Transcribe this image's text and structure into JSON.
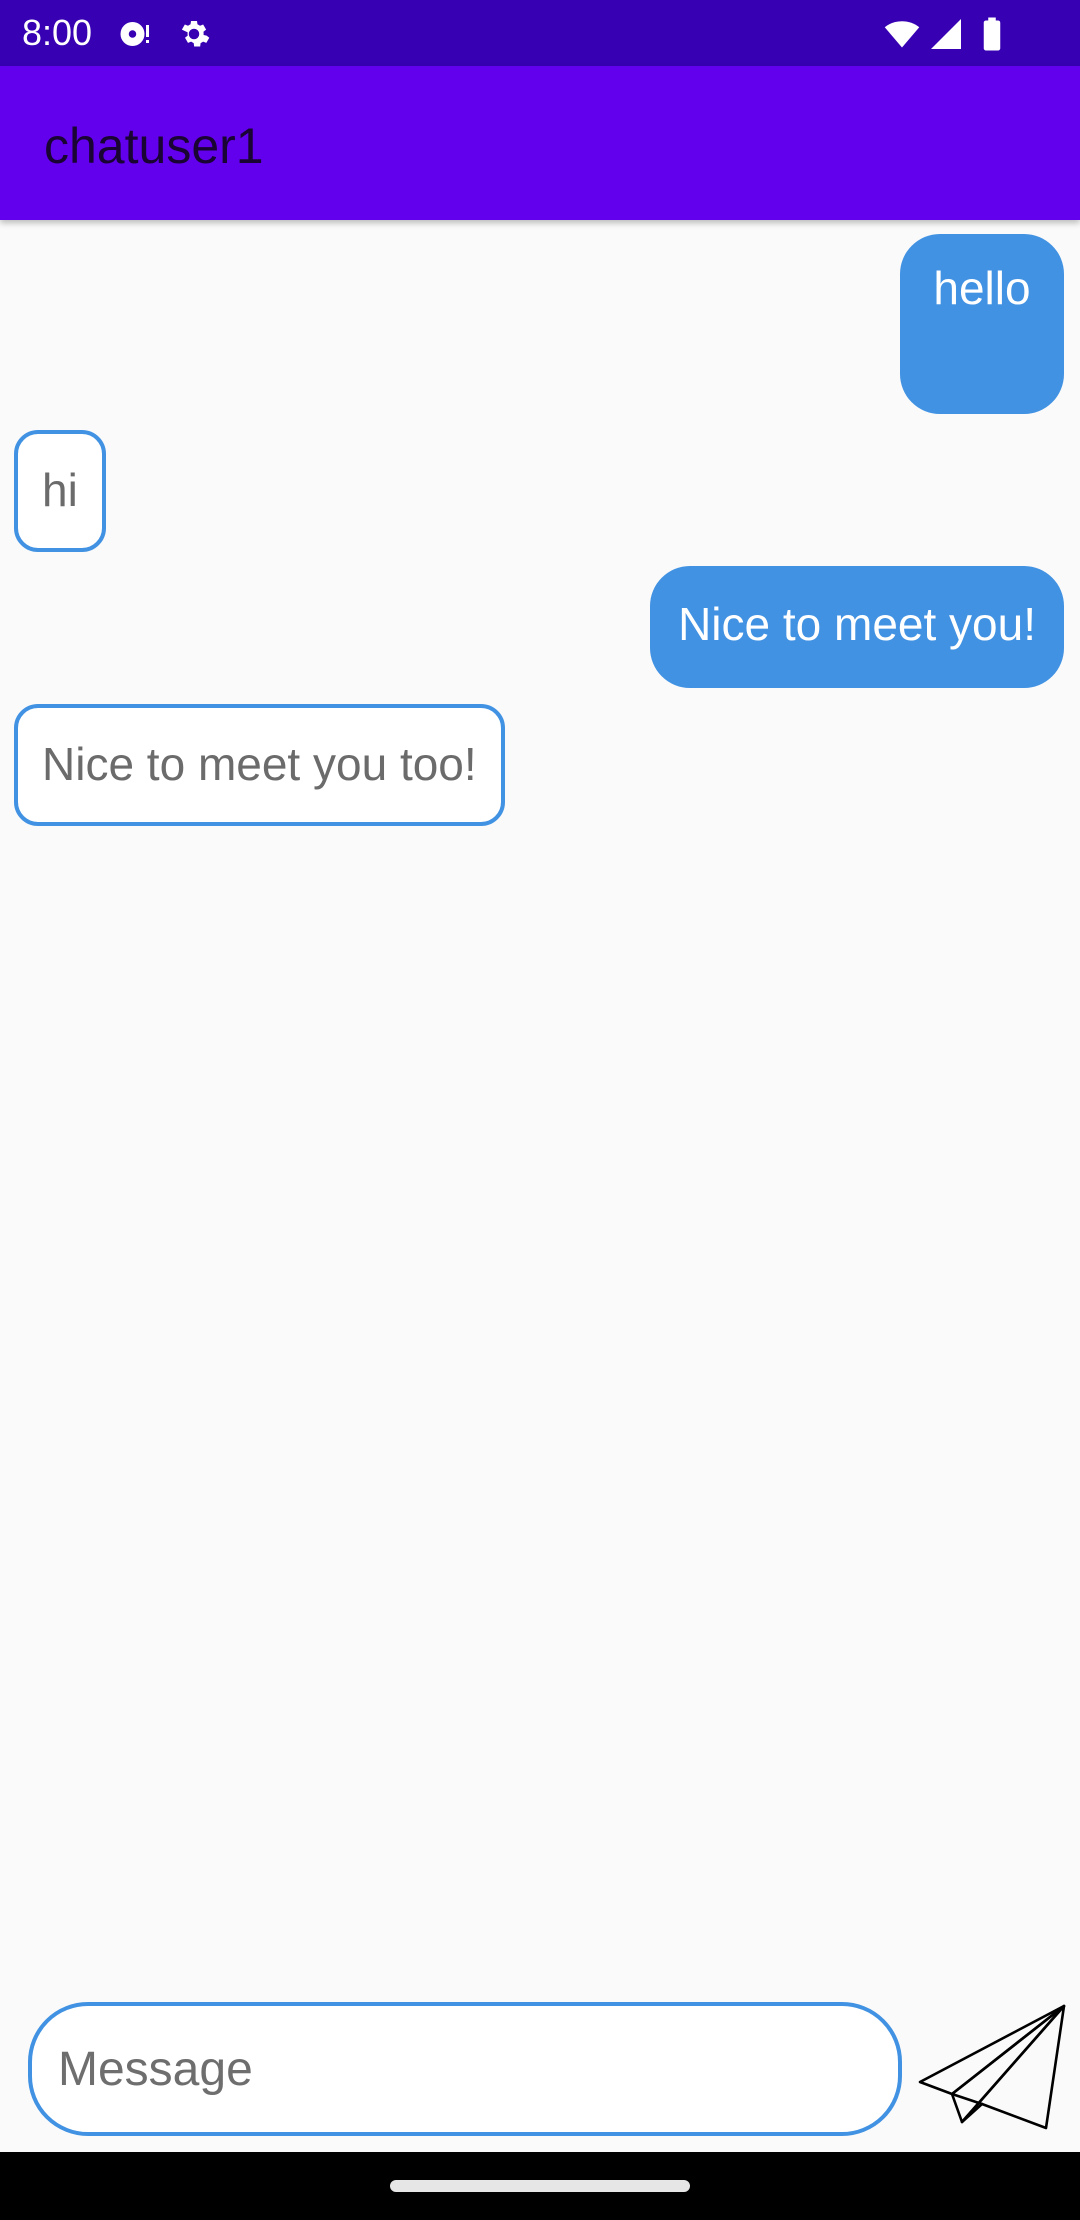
{
  "status_bar": {
    "time": "8:00",
    "icons": [
      "media-icon",
      "settings-icon",
      "wifi-icon",
      "signal-icon",
      "battery-icon"
    ],
    "background": "#3700B3"
  },
  "app_bar": {
    "title": "chatuser1",
    "background": "#6200EE"
  },
  "messages": [
    {
      "type": "sent",
      "text": "hello"
    },
    {
      "type": "received",
      "text": "hi"
    },
    {
      "type": "sent",
      "text": "Nice to meet you!"
    },
    {
      "type": "received",
      "text": "Nice to meet you too!"
    }
  ],
  "composer": {
    "placeholder": "Message",
    "value": "",
    "send_icon": "paper-plane-icon"
  },
  "colors": {
    "accent": "#4192E3",
    "background": "#FAFAFA"
  }
}
